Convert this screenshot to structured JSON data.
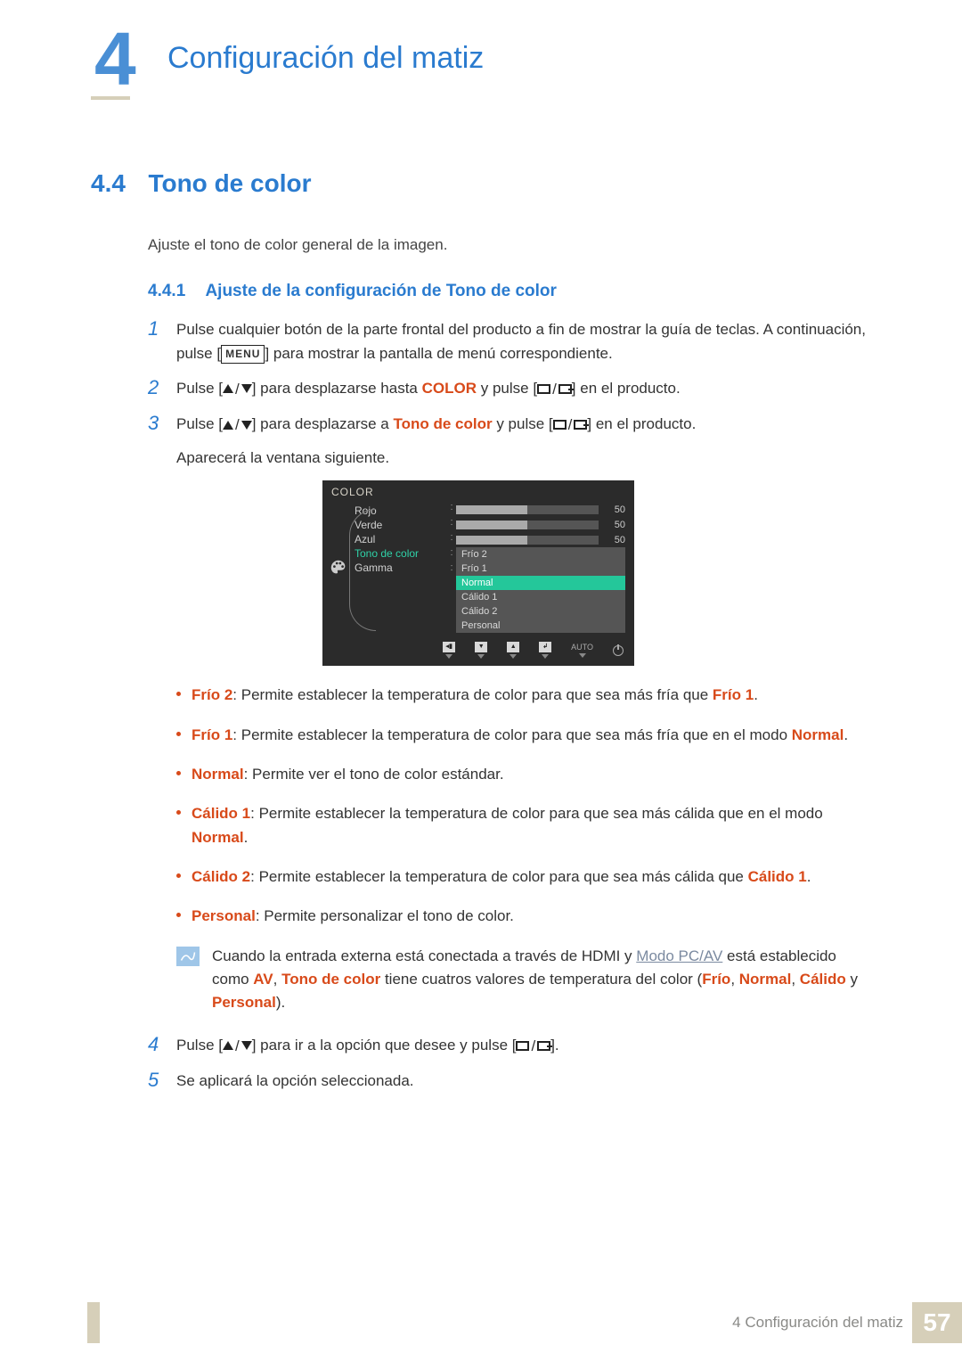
{
  "chapter": {
    "number": "4",
    "title": "Configuración del matiz"
  },
  "section": {
    "number": "4.4",
    "title": "Tono de color"
  },
  "intro": "Ajuste el tono de color general de la imagen.",
  "subsection": {
    "number": "4.4.1",
    "title": "Ajuste de la configuración de Tono de color"
  },
  "steps": [
    {
      "n": "1",
      "pre": "Pulse cualquier botón de la parte frontal del producto a fin de mostrar la guía de teclas. A continuación, pulse [",
      "badge": "MENU",
      "post": "] para mostrar la pantalla de menú correspondiente."
    },
    {
      "n": "2",
      "a": "Pulse [",
      "b": "] para desplazarse hasta ",
      "hl": "COLOR",
      "c": " y pulse [",
      "d": "] en el producto."
    },
    {
      "n": "3",
      "a": "Pulse [",
      "b": "] para desplazarse a ",
      "hl": "Tono de color",
      "c": " y pulse [",
      "d": "] en el producto.",
      "tail": "Aparecerá la ventana siguiente."
    },
    {
      "n": "4",
      "a": "Pulse [",
      "b": "] para ir a la opción que desee y pulse [",
      "d": "]."
    },
    {
      "n": "5",
      "plain": "Se aplicará la opción seleccionada."
    }
  ],
  "osd": {
    "title": "COLOR",
    "rows": [
      {
        "label": "Rojo",
        "value": "50"
      },
      {
        "label": "Verde",
        "value": "50"
      },
      {
        "label": "Azul",
        "value": "50"
      }
    ],
    "sel_label": "Tono de color",
    "gamma_label": "Gamma",
    "options": [
      "Frío 2",
      "Frío 1",
      "Normal",
      "Cálido 1",
      "Cálido 2",
      "Personal"
    ],
    "highlight_index": 2,
    "footer_auto": "AUTO"
  },
  "bullets": [
    {
      "hl": "Frío 2",
      "t1": ": Permite establecer la temperatura de color para que sea más fría que ",
      "hl2": "Frío 1",
      "t2": "."
    },
    {
      "hl": "Frío 1",
      "t1": ": Permite establecer la temperatura de color para que sea más fría que en el modo ",
      "hl2": "Normal",
      "t2": "."
    },
    {
      "hl": "Normal",
      "t1": ": Permite ver el tono de color estándar."
    },
    {
      "hl": "Cálido 1",
      "t1": ": Permite establecer la temperatura de color para que sea más cálida que en el modo ",
      "hl2": "Normal",
      "t2": "."
    },
    {
      "hl": "Cálido 2",
      "t1": ": Permite establecer la temperatura de color para que sea más cálida que ",
      "hl2": "Cálido 1",
      "t2": "."
    },
    {
      "hl": "Personal",
      "t1": ": Permite personalizar el tono de color."
    }
  ],
  "note": {
    "pre": "Cuando la entrada externa está conectada a través de HDMI y ",
    "link": "Modo PC/AV",
    "mid": " está establecido como ",
    "hl1": "AV",
    "mid2": ", ",
    "hl2": "Tono de color",
    "mid3": " tiene cuatros valores de temperatura del color (",
    "hl3": "Frío",
    "sep": ", ",
    "hl4": "Normal",
    "hl5": "Cálido",
    "mid4": " y ",
    "hl6": "Personal",
    "end": ")."
  },
  "footer": {
    "chapter_ref": "4 Configuración del matiz",
    "page": "57"
  }
}
